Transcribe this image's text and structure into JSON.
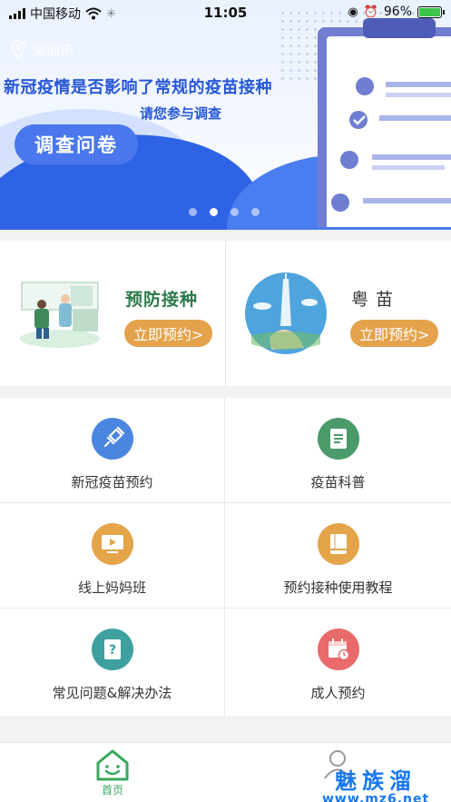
{
  "status_bar": {
    "carrier": "中国移动",
    "time": "11:05",
    "battery": "96%"
  },
  "banner": {
    "location": "深圳市",
    "headline": "新冠疫情是否影响了常规的疫苗接种",
    "subtitle": "请您参与调查",
    "button": "调查问卷",
    "pages": 4,
    "active_page": 2
  },
  "cards": [
    {
      "title": "预防接种",
      "button": "立即预约>"
    },
    {
      "title": "粤  苗",
      "button": "立即预约>"
    }
  ],
  "menu": [
    {
      "label": "新冠疫苗预约",
      "icon": "syringe-icon",
      "color": "#4a86e0"
    },
    {
      "label": "疫苗科普",
      "icon": "document-icon",
      "color": "#4a9a6a"
    },
    {
      "label": "线上妈妈班",
      "icon": "video-play-icon",
      "color": "#e3a44a"
    },
    {
      "label": "预约接种使用教程",
      "icon": "book-icon",
      "color": "#e3a44a"
    },
    {
      "label": "常见问题&解决办法",
      "icon": "question-book-icon",
      "color": "#3fa0a0"
    },
    {
      "label": "成人预约",
      "icon": "calendar-clock-icon",
      "color": "#e86a6a"
    }
  ],
  "tabbar": {
    "home": "首页"
  },
  "watermark": {
    "line1": "魅族溜",
    "line2": "www.mz6.net"
  }
}
